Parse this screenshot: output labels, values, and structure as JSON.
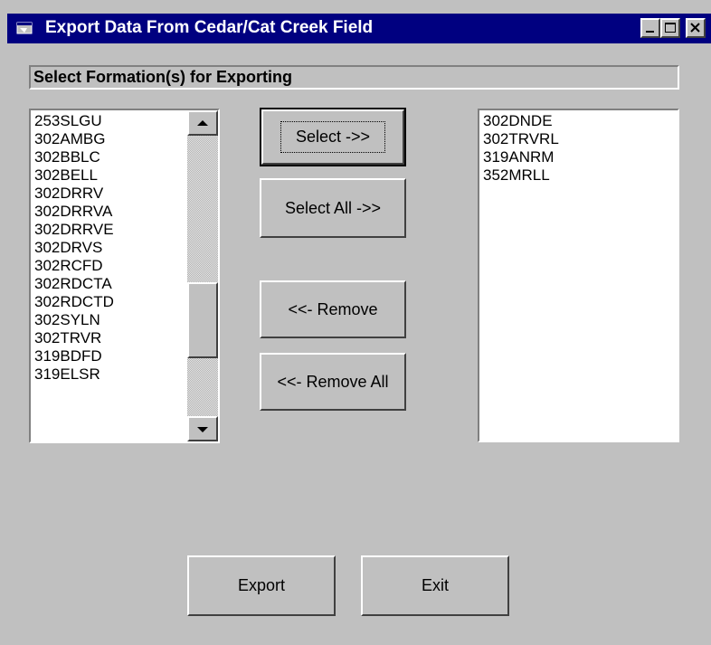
{
  "window": {
    "title": "Export Data From Cedar/Cat Creek Field",
    "colors": {
      "titlebar": "#000080",
      "face": "#c0c0c0"
    }
  },
  "header": {
    "label": "Select Formation(s) for Exporting"
  },
  "available_list": {
    "items": [
      "253SLGU",
      "302AMBG",
      "302BBLC",
      "302BELL",
      "302DRRV",
      "302DRRVA",
      "302DRRVE",
      "302DRVS",
      "302RCFD",
      "302RDCTA",
      "302RDCTD",
      "302SYLN",
      "302TRVR",
      "319BDFD",
      "319ELSR"
    ]
  },
  "selected_list": {
    "items": [
      "302DNDE",
      "302TRVRL",
      "319ANRM",
      "352MRLL"
    ]
  },
  "buttons": {
    "select": "Select ->>",
    "select_all": "Select All ->>",
    "remove": "<<- Remove",
    "remove_all": "<<- Remove All",
    "export": "Export",
    "exit": "Exit"
  },
  "icons": {
    "app": "window-app-icon",
    "minimize": "minimize-icon",
    "maximize": "maximize-icon",
    "close": "close-icon",
    "scroll_up": "arrow-up-icon",
    "scroll_down": "arrow-down-icon"
  }
}
